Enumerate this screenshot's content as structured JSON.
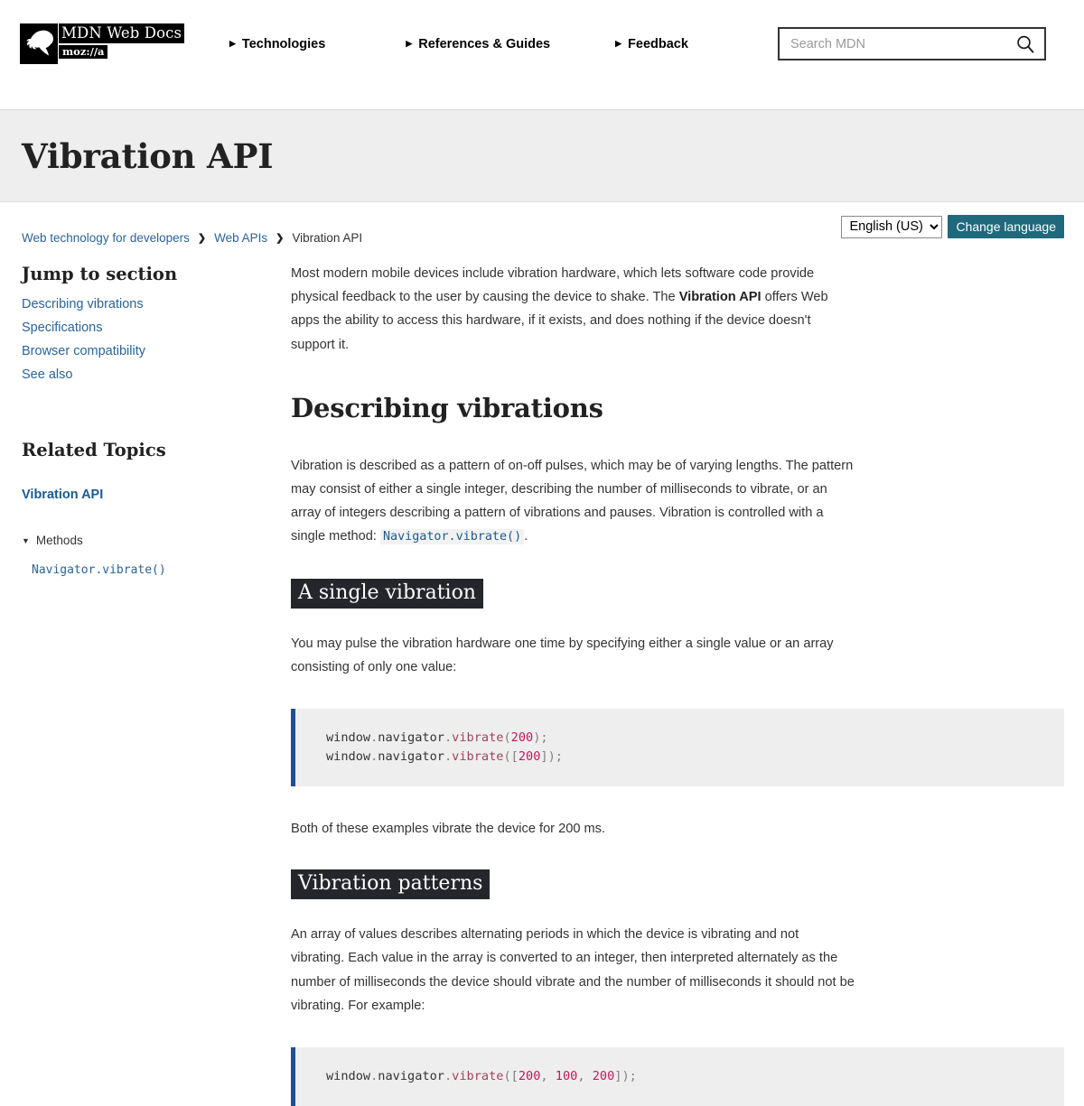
{
  "header": {
    "logo": {
      "wordmark": "MDN Web Docs",
      "moz": "moz://a",
      "alt": "mdn-dino-logo"
    },
    "nav": [
      {
        "label": "Technologies",
        "caret": "▶"
      },
      {
        "label": "References & Guides",
        "caret": "▶"
      },
      {
        "label": "Feedback",
        "caret": "▶"
      }
    ],
    "search": {
      "placeholder": "Search MDN",
      "value": "",
      "icon": "search-icon"
    }
  },
  "title_band": {
    "title": "Vibration API"
  },
  "breadcrumb": {
    "items": [
      {
        "label": "Web technology for developers",
        "link": true
      },
      {
        "label": "Web APIs",
        "link": true
      },
      {
        "label": "Vibration API",
        "link": false
      }
    ],
    "separator": "❯"
  },
  "language": {
    "selected": "English (US)",
    "options": [
      "English (US)"
    ],
    "change_button": "Change language"
  },
  "sidebar": {
    "jump_heading": "Jump to section",
    "jump_links": [
      "Describing vibrations",
      "Specifications",
      "Browser compatibility",
      "See also"
    ],
    "related_heading": "Related Topics",
    "related_current": "Vibration API",
    "group": {
      "caret": "▼",
      "label": "Methods"
    },
    "group_items": [
      "Navigator.vibrate()"
    ]
  },
  "article": {
    "intro": {
      "part1": "Most modern mobile devices include vibration hardware, which lets software code provide physical feedback to the user by causing the device to shake. The ",
      "bold": "Vibration API",
      "part2": " offers Web apps the ability to access this hardware, if it exists, and does nothing if the device doesn't support it."
    },
    "h2_describing": "Describing vibrations",
    "describing_para": {
      "part1": "Vibration is described as a pattern of on-off pulses, which may be of varying lengths. The pattern may consist of either a single integer, describing the number of milliseconds to vibrate, or an array of integers describing a pattern of vibrations and pauses. Vibration is controlled with a single method: ",
      "code": "Navigator.vibrate()",
      "part2": "."
    },
    "h3_single": "A single vibration",
    "single_para": "You may pulse the vibration hardware one time by specifying either a single value or an array consisting of only one value:",
    "code_single": {
      "lines": [
        [
          {
            "t": "window",
            "c": "plain"
          },
          {
            "t": ".",
            "c": "punc"
          },
          {
            "t": "navigator",
            "c": "plain"
          },
          {
            "t": ".",
            "c": "punc"
          },
          {
            "t": "vibrate",
            "c": "fn"
          },
          {
            "t": "(",
            "c": "punc"
          },
          {
            "t": "200",
            "c": "num"
          },
          {
            "t": ")",
            "c": "punc"
          },
          {
            "t": ";",
            "c": "punc"
          }
        ],
        [
          {
            "t": "window",
            "c": "plain"
          },
          {
            "t": ".",
            "c": "punc"
          },
          {
            "t": "navigator",
            "c": "plain"
          },
          {
            "t": ".",
            "c": "punc"
          },
          {
            "t": "vibrate",
            "c": "fn"
          },
          {
            "t": "(",
            "c": "punc"
          },
          {
            "t": "[",
            "c": "punc"
          },
          {
            "t": "200",
            "c": "num"
          },
          {
            "t": "]",
            "c": "punc"
          },
          {
            "t": ")",
            "c": "punc"
          },
          {
            "t": ";",
            "c": "punc"
          }
        ]
      ]
    },
    "both_para": "Both of these examples vibrate the device for 200 ms.",
    "h3_patterns": "Vibration patterns",
    "patterns_para": "An array of values describes alternating periods in which the device is vibrating and not vibrating. Each value in the array is converted to an integer, then interpreted alternately as the number of milliseconds the device should vibrate and the number of milliseconds it should not be vibrating. For example:",
    "code_patterns": {
      "lines": [
        [
          {
            "t": "window",
            "c": "plain"
          },
          {
            "t": ".",
            "c": "punc"
          },
          {
            "t": "navigator",
            "c": "plain"
          },
          {
            "t": ".",
            "c": "punc"
          },
          {
            "t": "vibrate",
            "c": "fn"
          },
          {
            "t": "(",
            "c": "punc"
          },
          {
            "t": "[",
            "c": "punc"
          },
          {
            "t": "200",
            "c": "num"
          },
          {
            "t": ", ",
            "c": "punc"
          },
          {
            "t": "100",
            "c": "num"
          },
          {
            "t": ", ",
            "c": "punc"
          },
          {
            "t": "200",
            "c": "num"
          },
          {
            "t": "]",
            "c": "punc"
          },
          {
            "t": ")",
            "c": "punc"
          },
          {
            "t": ";",
            "c": "punc"
          }
        ]
      ]
    }
  },
  "colors": {
    "accent_link": "#2a6496",
    "button_teal": "#20697c",
    "code_bg": "#eeeeee",
    "code_border": "#22508f",
    "h3_bg": "#24262b",
    "title_band_bg": "#eeeeee",
    "token_function": "#a1445a",
    "token_number": "#c2185b"
  }
}
